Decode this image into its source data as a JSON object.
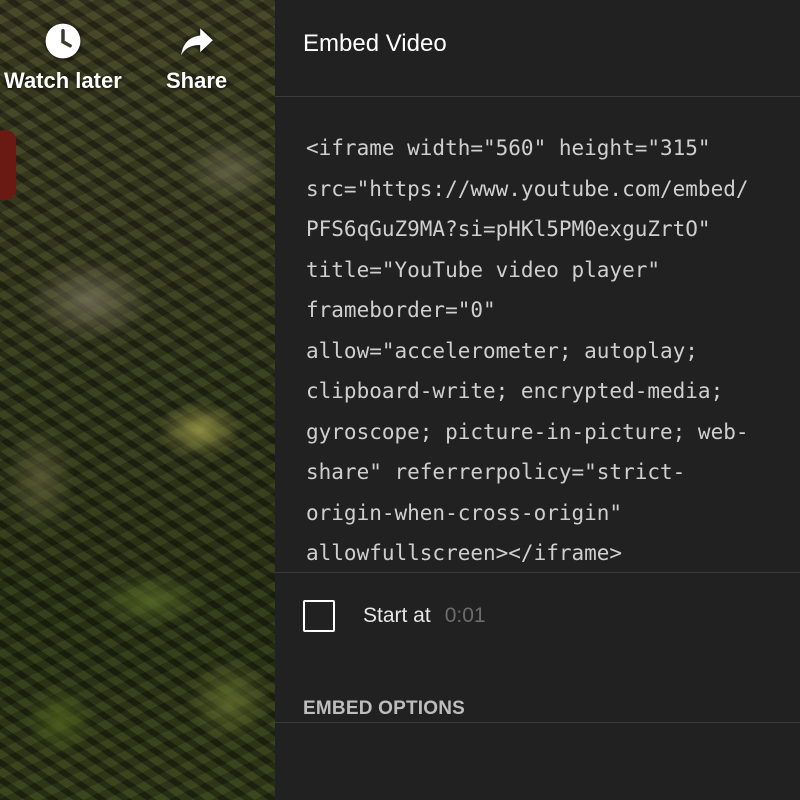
{
  "overlay": {
    "watch_later_label": "Watch later",
    "share_label": "Share",
    "watch_later_icon": "clock-icon",
    "share_icon": "share-arrow-icon"
  },
  "panel": {
    "title": "Embed Video",
    "embed_code_lines": [
      "<iframe width=\"560\" height=\"315\"",
      "src=\"https://www.youtube.com/embed/",
      "PFS6qGuZ9MA?si=pHKl5PM0exguZrtO\"",
      "title=\"YouTube video player\"",
      "frameborder=\"0\"",
      "allow=\"accelerometer; autoplay;",
      "clipboard-write; encrypted-media;",
      "gyroscope; picture-in-picture; web-",
      "share\" referrerpolicy=\"strict-",
      "origin-when-cross-origin\"",
      "allowfullscreen></iframe>"
    ],
    "start_at_label": "Start at",
    "start_at_time": "0:01",
    "start_at_checked": false,
    "embed_options_label": "EMBED OPTIONS"
  },
  "colors": {
    "panel_background": "#212121",
    "code_text": "#cfcfcf",
    "divider": "#3a3a3a",
    "muted_time": "#6c6c6c"
  }
}
